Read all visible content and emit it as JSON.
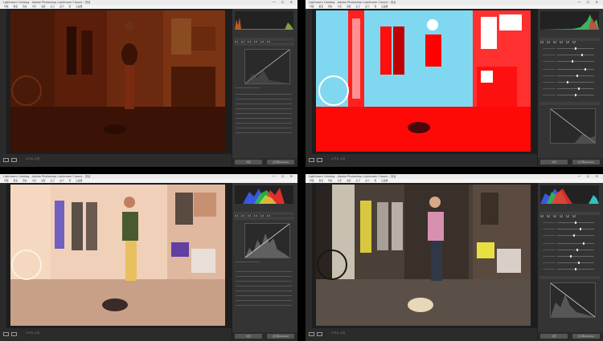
{
  "windows": [
    {
      "id": "top-left",
      "title": "Lightroom Catalog - Adobe Photoshop Lightroom Classic - 현상",
      "mode": "orange",
      "histogram": "mono-orange"
    },
    {
      "id": "top-right",
      "title": "Lightroom Catalog - Adobe Photoshop Lightroom Classic - 현상",
      "mode": "red-cyan",
      "histogram": "mono-green"
    },
    {
      "id": "bottom-left",
      "title": "Lightroom Catalog - Adobe Photoshop Lightroom Classic - 현상",
      "mode": "inverted",
      "histogram": "rgb"
    },
    {
      "id": "bottom-right",
      "title": "Lightroom Catalog - Adobe Photoshop Lightroom Classic - 현상",
      "mode": "normal",
      "histogram": "rgb"
    }
  ],
  "menu": [
    "파일",
    "편집",
    "현상",
    "사진",
    "설정",
    "도구",
    "보기",
    "창",
    "도움말"
  ],
  "window_controls": "— ☐ ✕",
  "bottom_label": "소프트 교정",
  "buttons": {
    "previous": "이전",
    "reset": "초기화(Adobe)"
  },
  "colors": {
    "panel": "#343434",
    "background": "#1e1e1e",
    "accent": "#ff0000"
  }
}
